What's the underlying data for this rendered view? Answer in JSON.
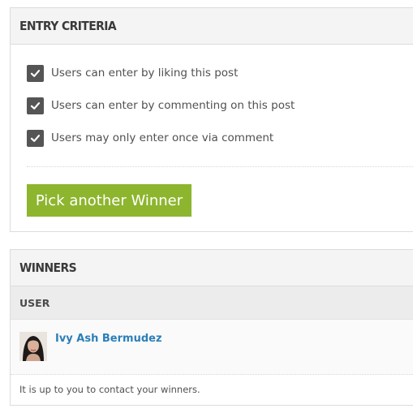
{
  "entry_criteria": {
    "title": "Entry Criteria",
    "items": [
      {
        "label": "Users can enter by liking this post",
        "checked": true,
        "icon": "check-icon"
      },
      {
        "label": "Users can enter by commenting on this post",
        "checked": true,
        "icon": "check-icon"
      },
      {
        "label": "Users may only enter once via comment",
        "checked": true,
        "icon": "check-icon"
      }
    ],
    "pick_button_label": "Pick another Winner"
  },
  "winners": {
    "title": "Winners",
    "column_user": "User",
    "rows": [
      {
        "name": "Ivy Ash Bermudez",
        "avatar": "user-avatar"
      }
    ],
    "note": "It is up to you to contact your winners."
  },
  "colors": {
    "accent_green": "#8db52e",
    "link_blue": "#2a7fb8",
    "checkbox_gray": "#555555"
  }
}
